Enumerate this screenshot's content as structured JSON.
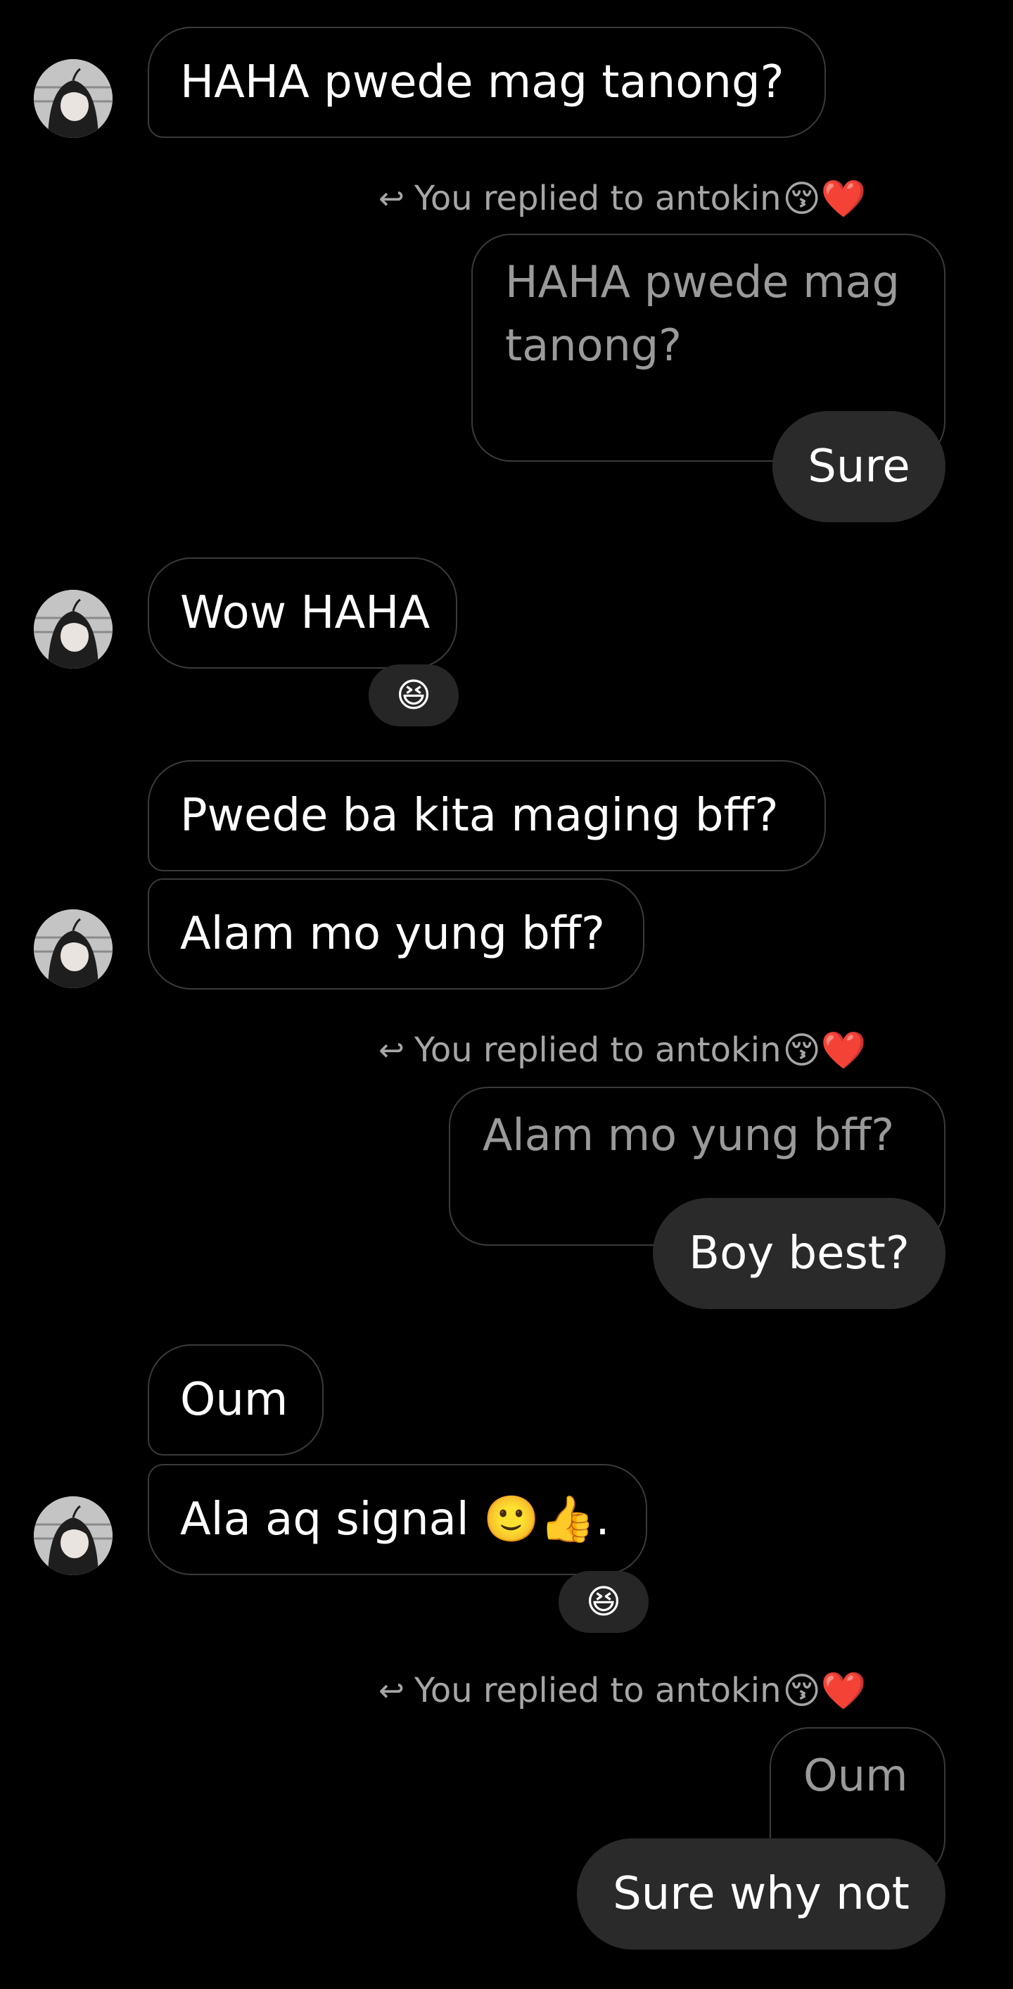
{
  "colors": {
    "background": "#000000",
    "incoming_border": "#3a3a3a",
    "outgoing_fill": "#2a2a2a",
    "reply_header_text": "#a6a6a6",
    "reaction_fill": "#262626"
  },
  "contact": {
    "avatar_icon": "anime-girl-avatar-icon"
  },
  "messages": {
    "m1": {
      "text": "HAHA pwede mag tanong?"
    },
    "r1": {
      "arrow": "↩",
      "label": "You replied to antokin",
      "emoji": "😚❤️",
      "quote": "HAHA pwede mag tanong?",
      "reply": "Sure"
    },
    "m2": {
      "text": "Wow HAHA",
      "reaction": "😆"
    },
    "m3": {
      "text": "Pwede ba kita maging bff?"
    },
    "m4": {
      "text": "Alam mo yung bff?"
    },
    "r2": {
      "arrow": "↩",
      "label": "You replied to antokin",
      "emoji": "😚❤️",
      "quote": "Alam mo yung bff?",
      "reply": "Boy best?"
    },
    "m5": {
      "text": "Oum"
    },
    "m6": {
      "text": "Ala aq signal 🙂👍.",
      "reaction": "😆"
    },
    "r3": {
      "arrow": "↩",
      "label": "You replied to antokin",
      "emoji": "😚❤️",
      "quote": "Oum",
      "reply": "Sure why not"
    }
  }
}
